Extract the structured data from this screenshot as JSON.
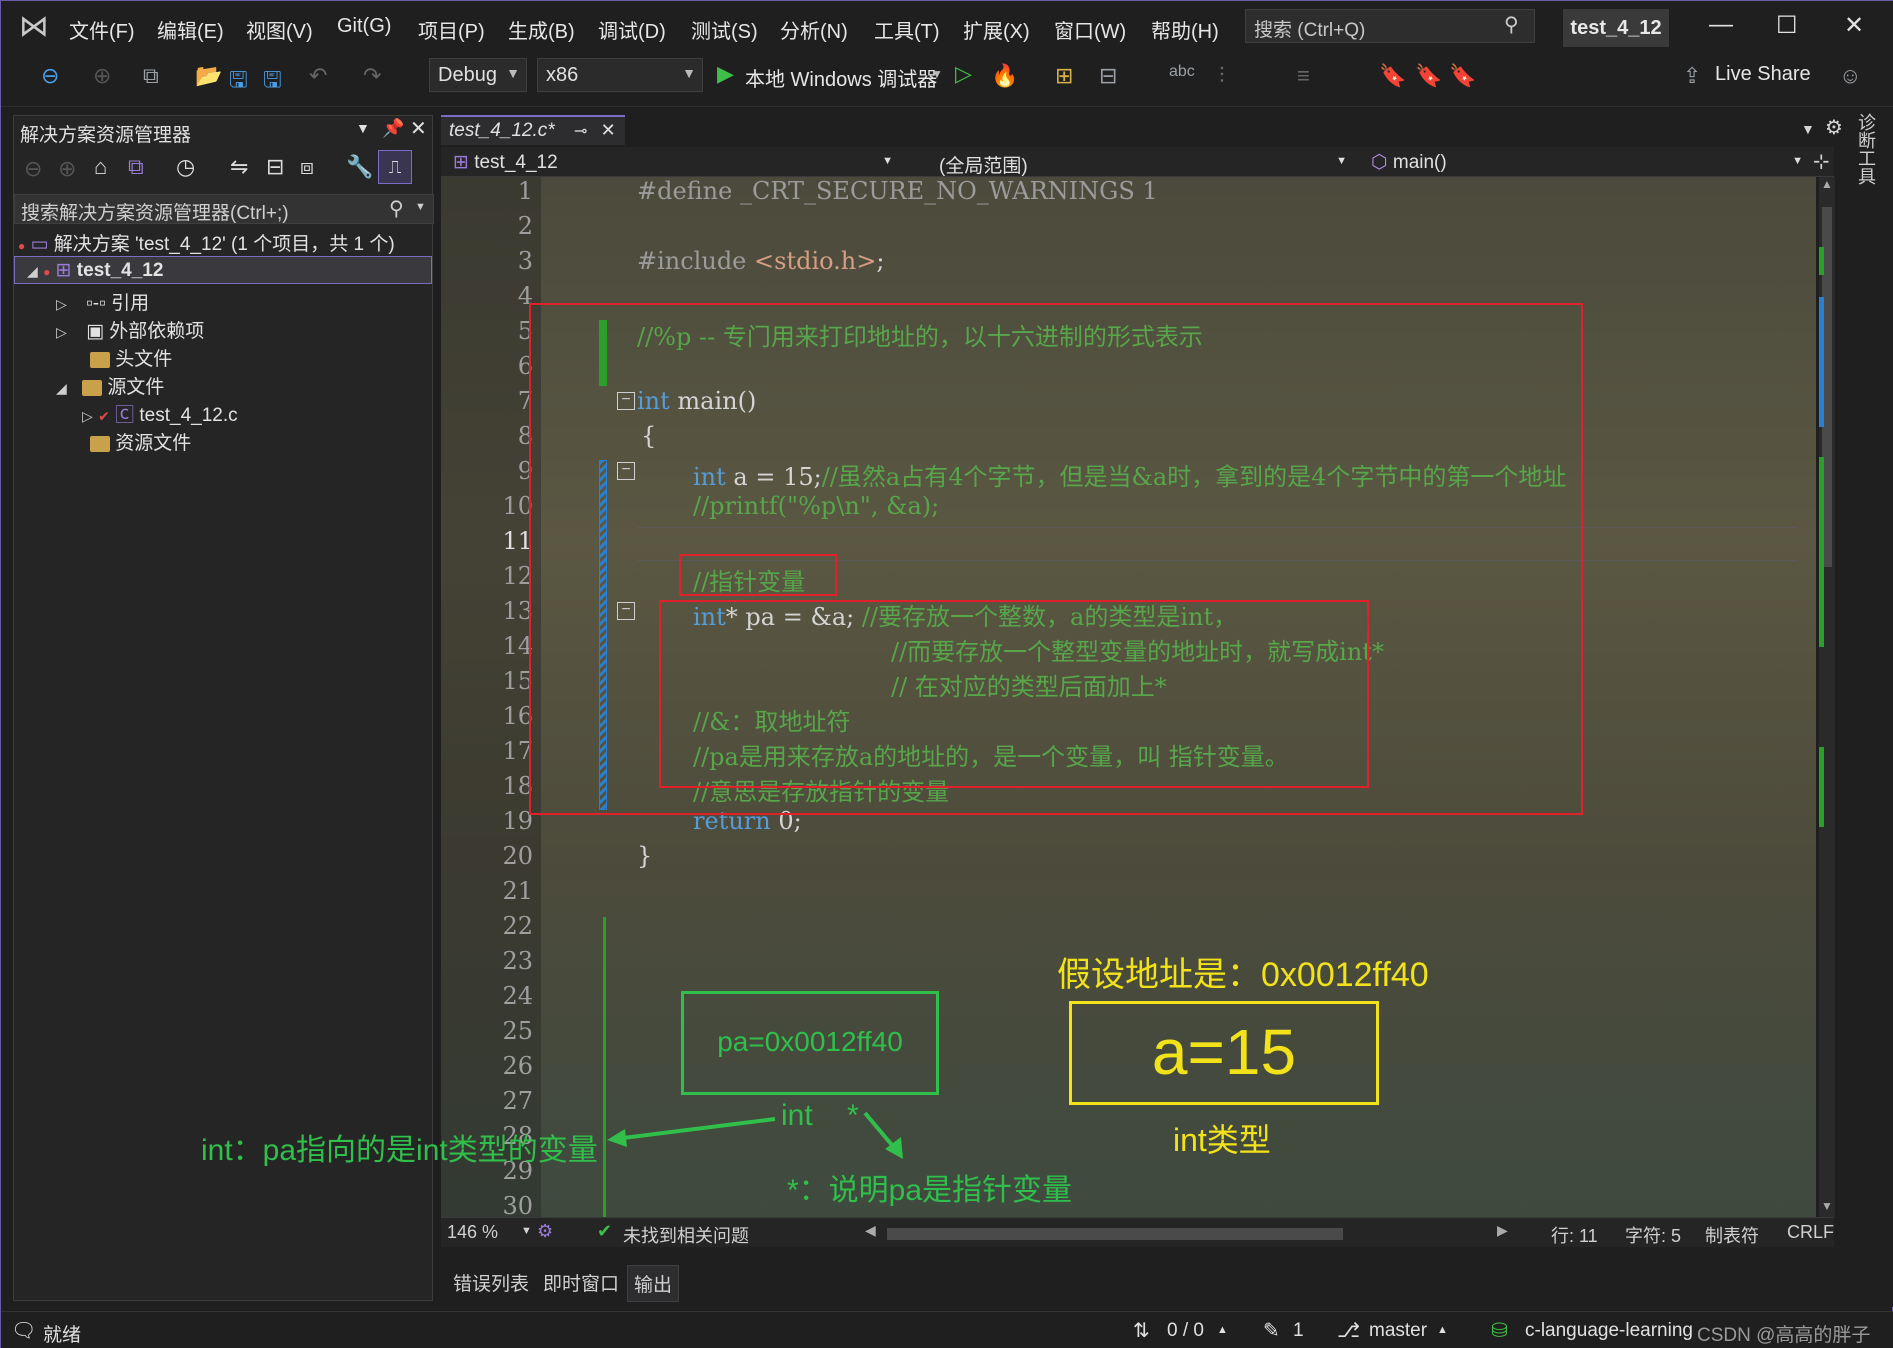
{
  "menu": {
    "items": [
      "文件(F)",
      "编辑(E)",
      "视图(V)",
      "Git(G)",
      "项目(P)",
      "生成(B)",
      "调试(D)",
      "测试(S)",
      "分析(N)",
      "工具(T)",
      "扩展(X)",
      "窗口(W)",
      "帮助(H)"
    ],
    "search_placeholder": "搜索 (Ctrl+Q)",
    "window_title": "test_4_12"
  },
  "toolbar": {
    "config": "Debug",
    "platform": "x86",
    "debugger_label": "本地 Windows 调试器",
    "live_share": "Live Share"
  },
  "solution_explorer": {
    "title": "解决方案资源管理器",
    "search_placeholder": "搜索解决方案资源管理器(Ctrl+;)",
    "solution": "解决方案 'test_4_12' (1 个项目，共 1 个)",
    "project": "test_4_12",
    "nodes": [
      "引用",
      "外部依赖项",
      "头文件",
      "源文件",
      "test_4_12.c",
      "资源文件"
    ]
  },
  "editor": {
    "tab_label": "test_4_12.c*",
    "nav_project": "test_4_12",
    "nav_scope": "(全局范围)",
    "nav_function": "main()",
    "line_numbers": [
      "1",
      "2",
      "3",
      "4",
      "5",
      "6",
      "7",
      "8",
      "9",
      "10",
      "11",
      "12",
      "13",
      "14",
      "15",
      "16",
      "17",
      "18",
      "19",
      "20",
      "21",
      "22",
      "23",
      "24",
      "25",
      "26",
      "27",
      "28",
      "29",
      "30"
    ],
    "code": {
      "l1": "#define _CRT_SECURE_NO_WARNINGS 1",
      "l3a": "#include ",
      "l3b": "<stdio.h>",
      "l3c": ";",
      "l5": "//%p -- 专门用来打印地址的，以十六进制的形式表示",
      "l7a": "int",
      "l7b": " main()",
      "l8": "{",
      "l9a": "int",
      "l9b": " a = 15;",
      "l9c": "//虽然a占有4个字节，但是当&a时，拿到的是4个字节中的第一个地址",
      "l10": "//printf(\"%p\\n\", &a);",
      "l12": "//指针变量",
      "l13a": "int",
      "l13b": "* pa = &a; ",
      "l13c": "//要存放一个整数，a的类型是int，",
      "l14": "//而要存放一个整型变量的地址时，就写成int*",
      "l15": "// 在对应的类型后面加上*",
      "l16": "//&：取地址符",
      "l17": "//pa是用来存放a的地址的，是一个变量，叫 指针变量。",
      "l18": "//意思是存放指针的变量",
      "l19a": "return",
      "l19b": " 0;",
      "l20": "}"
    },
    "annotations": {
      "addr_title": "假设地址是：0x0012ff40",
      "a_value": "a=15",
      "a_type": "int类型",
      "pa_value": "pa=0x0012ff40",
      "int_label": "int",
      "star_label": "*",
      "int_explain": "int：pa指向的是int类型的变量",
      "star_explain": "*：说明pa是指针变量"
    },
    "zoom": "146 %",
    "issues": "未找到相关问题",
    "row": "行: 11",
    "col": "字符: 5",
    "indent": "制表符",
    "eol": "CRLF"
  },
  "bottom_tabs": [
    "错误列表",
    "即时窗口",
    "输出"
  ],
  "status": {
    "ready": "就绪",
    "sync": "0 / 0",
    "edits": "1",
    "branch": "master",
    "repo": "c-language-learning",
    "watermark": "CSDN @高高的胖子"
  },
  "right_strip_label": "诊断工具",
  "colors": {
    "accent": "#7a6cc8",
    "comment": "#57a64a",
    "keyword": "#569cd6",
    "annotation_yellow": "#f2e21a",
    "annotation_green": "#2fbf4a",
    "red_box": "#e0202a"
  }
}
